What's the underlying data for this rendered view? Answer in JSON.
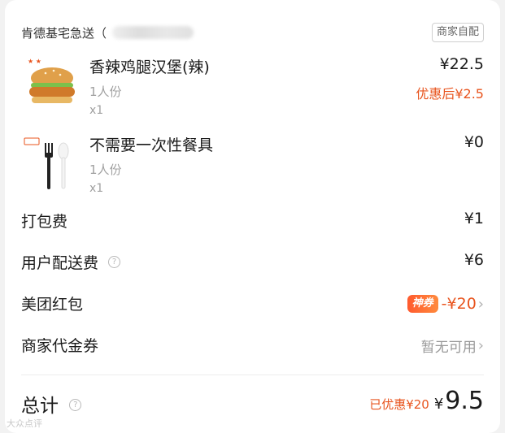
{
  "store": {
    "name": "肯德基宅急送（",
    "pickup_label": "商家自配"
  },
  "items": [
    {
      "title": "香辣鸡腿汉堡(辣)",
      "portion": "1人份",
      "qty": "x1",
      "price": "¥22.5",
      "discount": "优惠后¥2.5",
      "thumb_icon": "burger-icon"
    },
    {
      "title": "不需要一次性餐具",
      "portion": "1人份",
      "qty": "x1",
      "price": "¥0",
      "thumb_icon": "cutlery-icon"
    }
  ],
  "fees": {
    "pack_label": "打包费",
    "pack_value": "¥1",
    "delivery_label": "用户配送费",
    "delivery_value": "¥6",
    "redpacket_label": "美团红包",
    "redpacket_badge": "神券",
    "redpacket_value": "-¥20",
    "voucher_label": "商家代金券",
    "voucher_value": "暂无可用"
  },
  "total": {
    "label": "总计",
    "saved": "已优惠¥20",
    "symbol": "¥",
    "amount": "9.5"
  },
  "watermark": "大众点评",
  "colors": {
    "accent": "#e8541e",
    "muted": "#a0a0a0"
  }
}
